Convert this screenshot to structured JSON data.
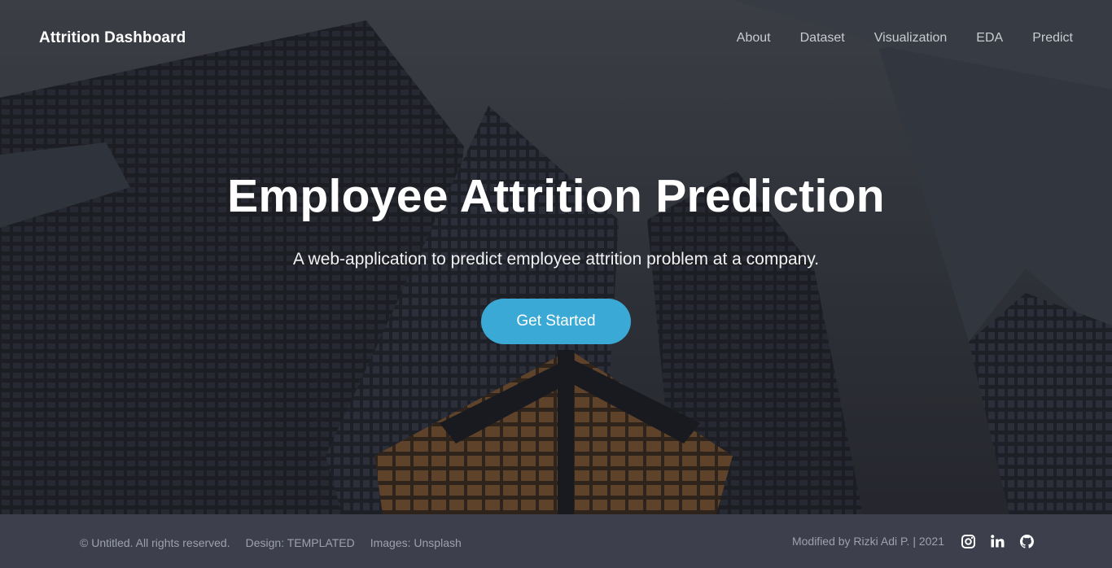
{
  "header": {
    "logo": "Attrition Dashboard",
    "nav": [
      {
        "label": "About"
      },
      {
        "label": "Dataset"
      },
      {
        "label": "Visualization"
      },
      {
        "label": "EDA"
      },
      {
        "label": "Predict"
      }
    ]
  },
  "hero": {
    "title": "Employee Attrition Prediction",
    "subtitle": "A web-application to predict employee attrition problem at a company.",
    "cta_label": "Get Started",
    "accent_color": "#3ba9d6"
  },
  "footer": {
    "copyright": "© Untitled. All rights reserved.",
    "design": "Design: TEMPLATED",
    "images": "Images: Unsplash",
    "modified": "Modified by Rizki Adi P. | 2021",
    "social": [
      {
        "icon": "instagram-icon"
      },
      {
        "icon": "linkedin-icon"
      },
      {
        "icon": "github-icon"
      }
    ]
  }
}
